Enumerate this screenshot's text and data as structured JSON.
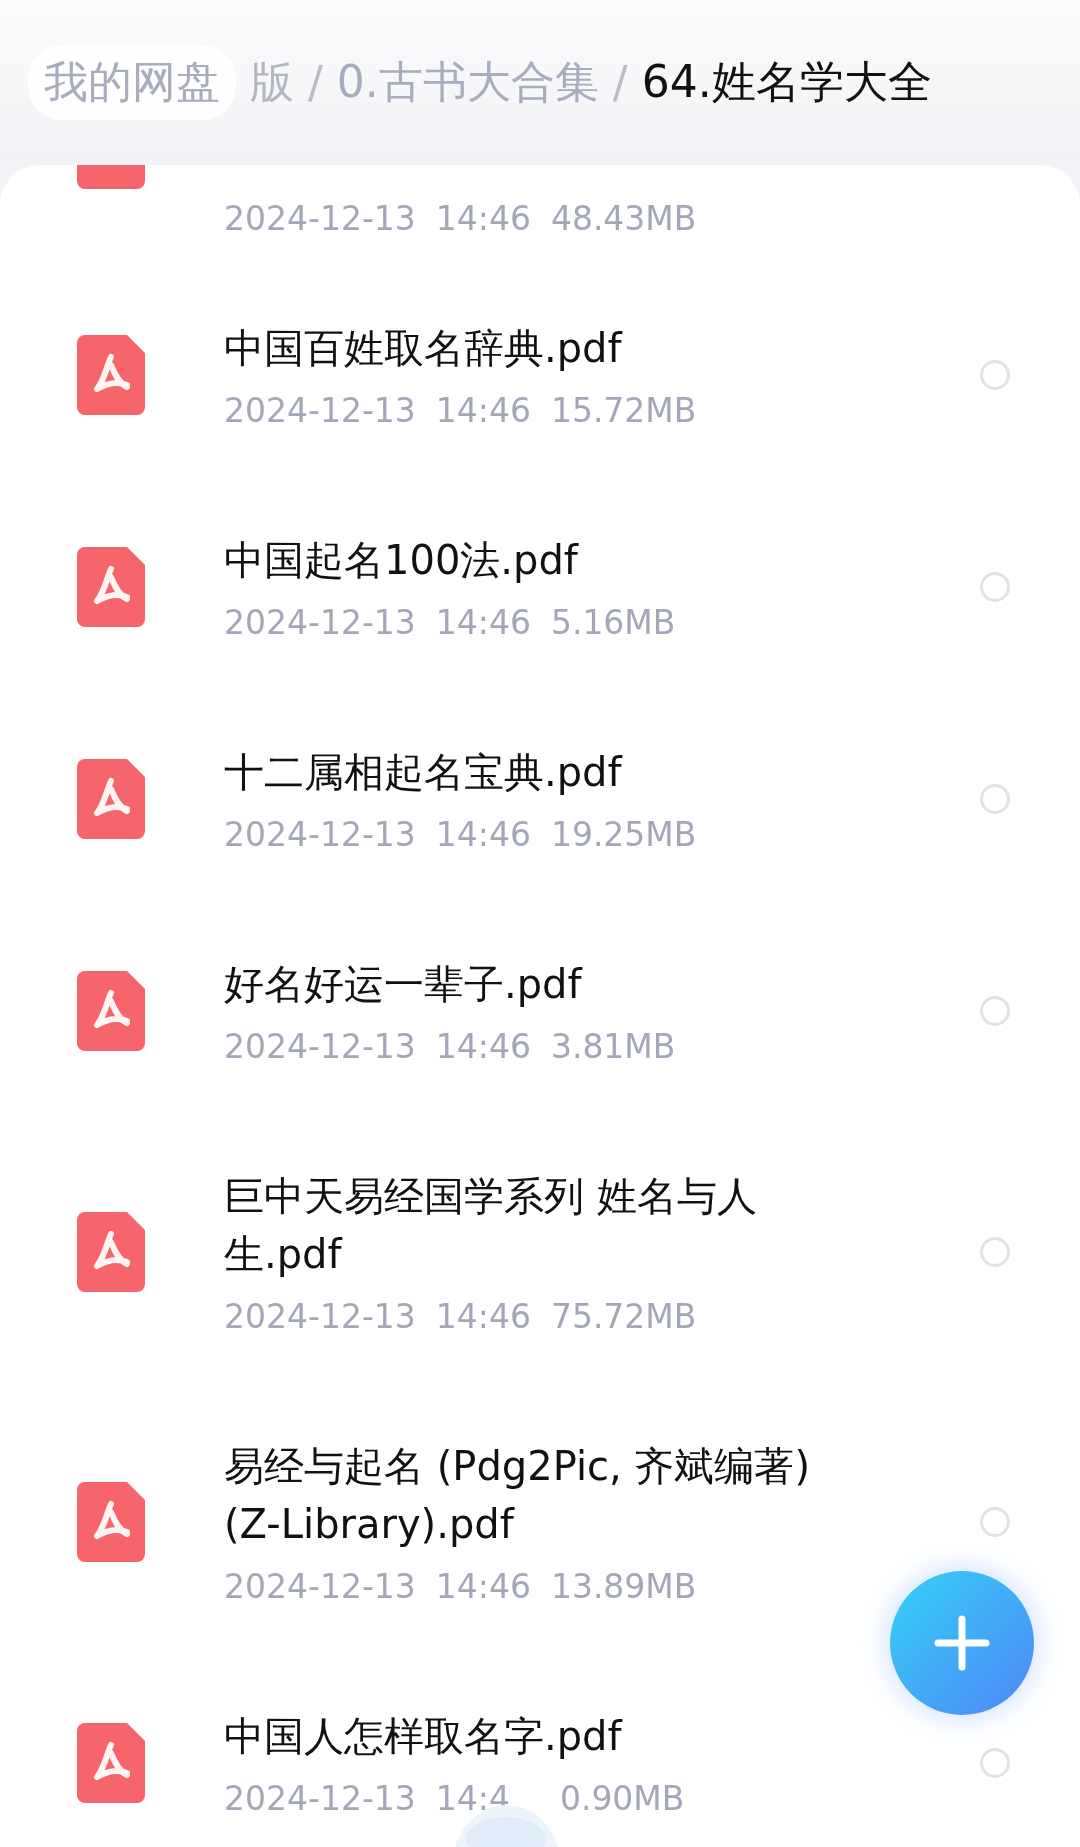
{
  "breadcrumb": {
    "root": "我的网盘",
    "items": [
      {
        "label": "版",
        "kind": "faded"
      },
      {
        "label": "/",
        "kind": "sep"
      },
      {
        "label": "0.古书大合集",
        "kind": "parent"
      },
      {
        "label": "/",
        "kind": "sep"
      },
      {
        "label": "64.姓名学大全",
        "kind": "current"
      }
    ]
  },
  "files": [
    {
      "kind": "cut",
      "date": "2024-12-13",
      "time": "14:46",
      "size": "48.43MB"
    },
    {
      "kind": "full",
      "name": "中国百姓取名辞典.pdf",
      "date": "2024-12-13",
      "time": "14:46",
      "size": "15.72MB",
      "selected": false
    },
    {
      "kind": "full",
      "name": "中国起名100法.pdf",
      "date": "2024-12-13",
      "time": "14:46",
      "size": "5.16MB",
      "selected": false
    },
    {
      "kind": "full",
      "name": "十二属相起名宝典.pdf",
      "date": "2024-12-13",
      "time": "14:46",
      "size": "19.25MB",
      "selected": false
    },
    {
      "kind": "full",
      "name": "好名好运一辈子.pdf",
      "date": "2024-12-13",
      "time": "14:46",
      "size": "3.81MB",
      "selected": false
    },
    {
      "kind": "full",
      "name": "巨中天易经国学系列 姓名与人生.pdf",
      "date": "2024-12-13",
      "time": "14:46",
      "size": "75.72MB",
      "selected": false
    },
    {
      "kind": "full",
      "name": "易经与起名 (Pdg2Pic, 齐斌编著) (Z-Library).pdf",
      "date": "2024-12-13",
      "time": "14:46",
      "size": "13.89MB",
      "selected": false
    },
    {
      "kind": "obscured",
      "name": "中国人怎样取名字.pdf",
      "date": "2024-12-13",
      "time": "14:4",
      "size": "0.90MB",
      "selected": false
    }
  ]
}
